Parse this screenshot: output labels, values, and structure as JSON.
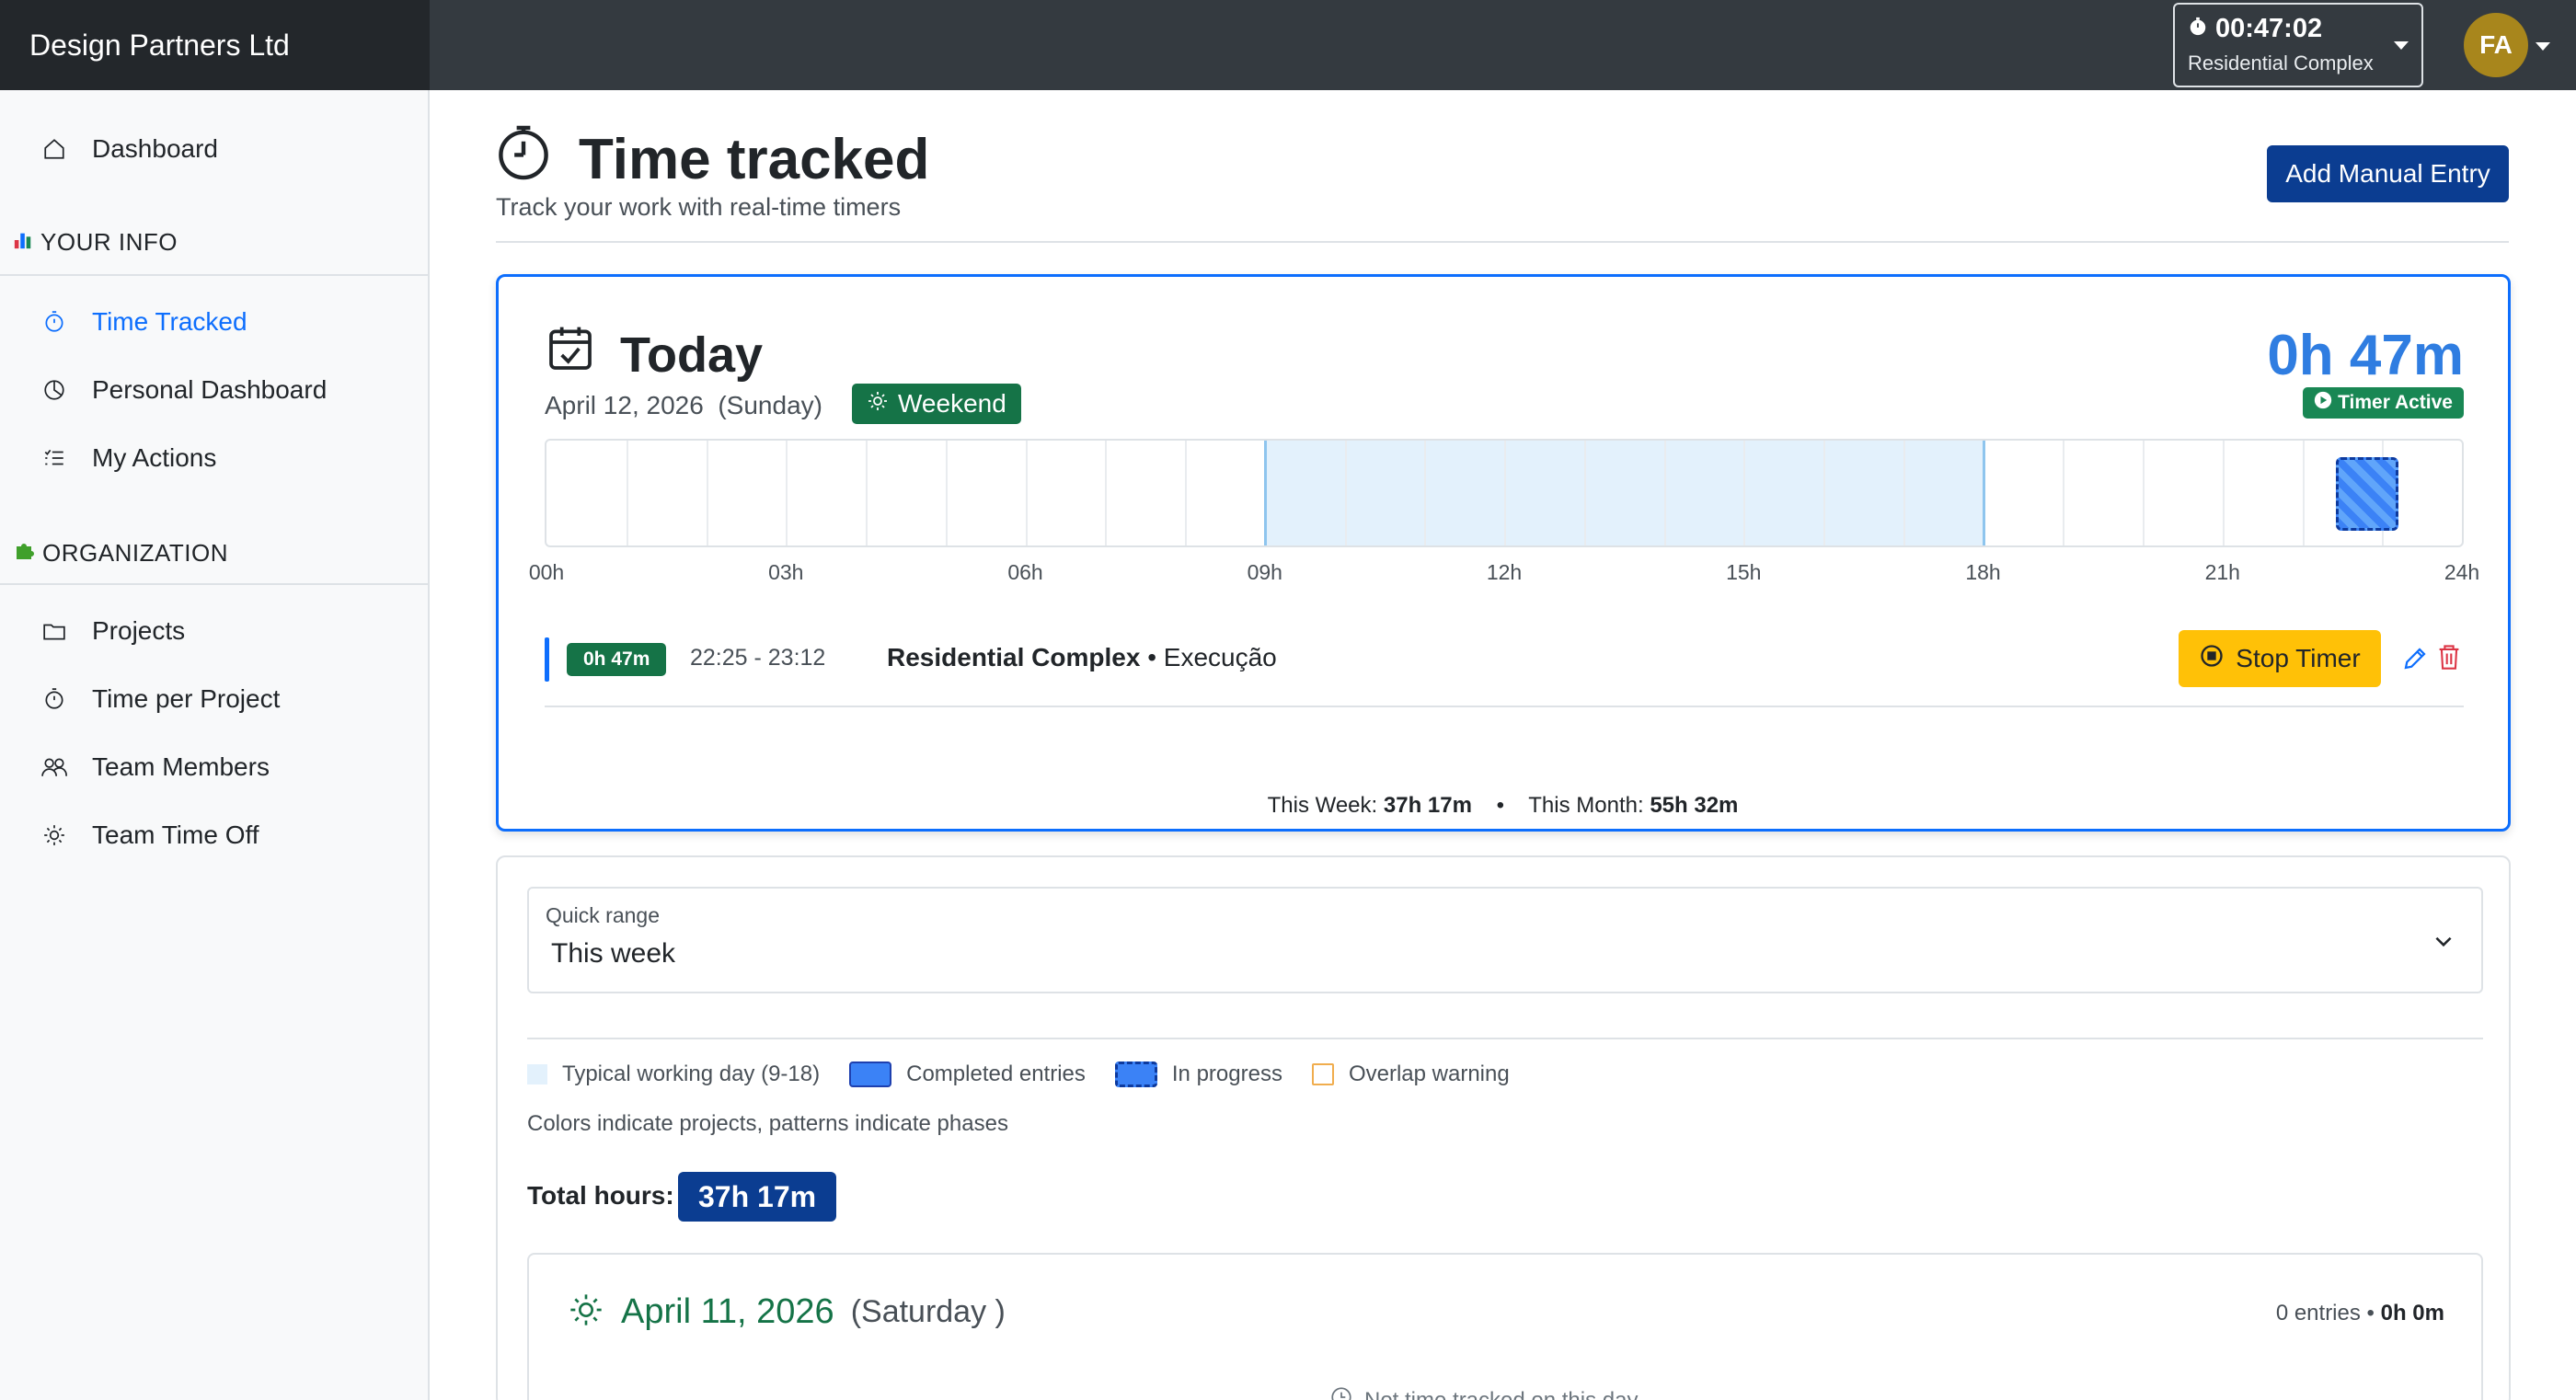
{
  "brand": "Design Partners Ltd",
  "topbar": {
    "timer_time": "00:47:02",
    "timer_project": "Residential Complex",
    "avatar_initials": "FA"
  },
  "sidebar": {
    "dashboard": "Dashboard",
    "section_your_info": "YOUR INFO",
    "your_info_items": [
      "Time Tracked",
      "Personal Dashboard",
      "My Actions"
    ],
    "section_org": "ORGANIZATION",
    "org_items": [
      "Projects",
      "Time per Project",
      "Team Members",
      "Team Time Off"
    ]
  },
  "page": {
    "title": "Time tracked",
    "subtitle": "Track your work with real-time timers",
    "add_button": "Add Manual Entry"
  },
  "today": {
    "title": "Today",
    "date": "April 12, 2026",
    "weekday": "(Sunday)",
    "badge": "Weekend",
    "total": "0h 47m",
    "status": "Timer Active",
    "ticks": [
      "00h",
      "03h",
      "06h",
      "09h",
      "12h",
      "15h",
      "18h",
      "21h",
      "24h"
    ],
    "entry": {
      "duration": "0h 47m",
      "range": "22:25 - 23:12",
      "project": "Residential Complex",
      "separator": "•",
      "phase": "Execução",
      "stop_label": "Stop Timer",
      "start_hour": 22.42,
      "end_hour": 23.2
    },
    "work_start_hour": 9,
    "work_end_hour": 18
  },
  "stats": {
    "week_label": "This Week:",
    "week_value": "37h 17m",
    "dot": "•",
    "month_label": "This Month:",
    "month_value": "55h 32m"
  },
  "filter": {
    "quick_range_label": "Quick range",
    "quick_range_value": "This week",
    "legend": [
      "Typical working day (9-18)",
      "Completed entries",
      "In progress",
      "Overlap warning"
    ],
    "legend_note": "Colors indicate projects, patterns indicate phases",
    "total_label": "Total hours:",
    "total_value": "37h 17m"
  },
  "day": {
    "date": "April 11, 2026",
    "weekday": "(Saturday )",
    "entries": "0 entries",
    "dot": "•",
    "hours": "0h 0m",
    "empty": "Not time tracked on this day"
  },
  "colors": {
    "primary": "#0d6efd",
    "navy": "#0b3d91",
    "success": "#157347",
    "warning": "#ffc107"
  }
}
